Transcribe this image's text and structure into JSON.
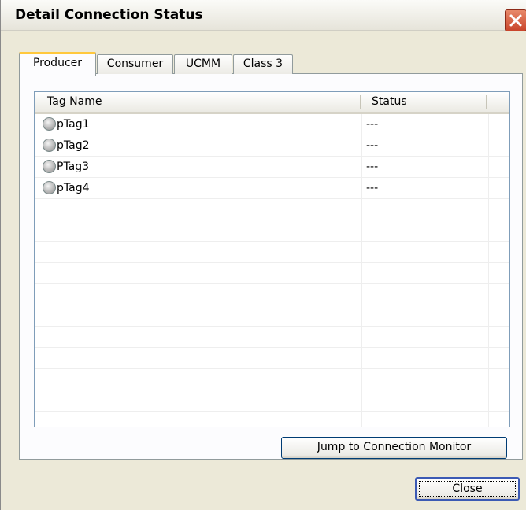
{
  "window": {
    "title": "Detail Connection Status"
  },
  "tabs": [
    {
      "label": "Producer",
      "active": true
    },
    {
      "label": "Consumer",
      "active": false
    },
    {
      "label": "UCMM",
      "active": false
    },
    {
      "label": "Class 3",
      "active": false
    }
  ],
  "table": {
    "columns": [
      "Tag Name",
      "Status"
    ],
    "rows": [
      {
        "tag": "pTag1",
        "status": "---"
      },
      {
        "tag": "pTag2",
        "status": "---"
      },
      {
        "tag": "PTag3",
        "status": "---"
      },
      {
        "tag": "pTag4",
        "status": "---"
      }
    ]
  },
  "buttons": {
    "jump_label": "Jump to Connection Monitor",
    "jump_mnemonic": "J",
    "jump_rest": "ump to Connection Monitor",
    "close_label": "Close"
  }
}
